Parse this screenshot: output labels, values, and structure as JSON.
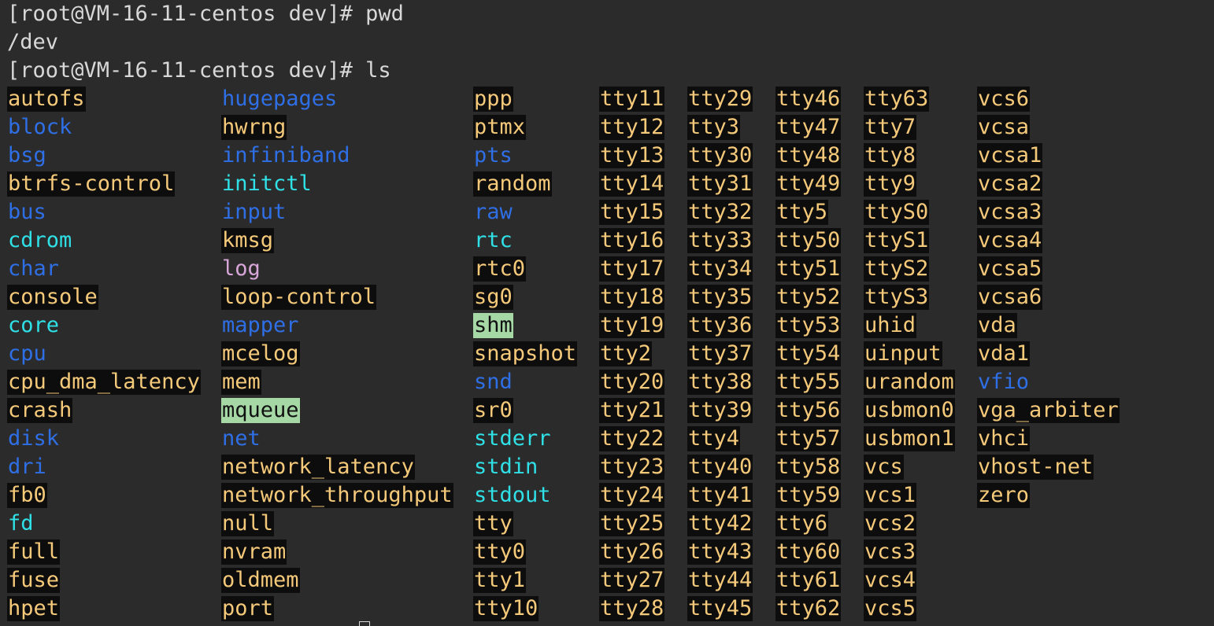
{
  "terminal": {
    "lines": [
      "[root@VM-16-11-centos dev]# pwd",
      "/dev",
      "[root@VM-16-11-centos dev]# ls"
    ],
    "columns": [
      [
        {
          "name": "autofs",
          "type": "dev"
        },
        {
          "name": "block",
          "type": "dir"
        },
        {
          "name": "bsg",
          "type": "dir"
        },
        {
          "name": "btrfs-control",
          "type": "dev"
        },
        {
          "name": "bus",
          "type": "dir"
        },
        {
          "name": "cdrom",
          "type": "link"
        },
        {
          "name": "char",
          "type": "dir"
        },
        {
          "name": "console",
          "type": "dev"
        },
        {
          "name": "core",
          "type": "link"
        },
        {
          "name": "cpu",
          "type": "dir"
        },
        {
          "name": "cpu_dma_latency",
          "type": "dev"
        },
        {
          "name": "crash",
          "type": "dev"
        },
        {
          "name": "disk",
          "type": "dir"
        },
        {
          "name": "dri",
          "type": "dir"
        },
        {
          "name": "fb0",
          "type": "dev"
        },
        {
          "name": "fd",
          "type": "link"
        },
        {
          "name": "full",
          "type": "dev"
        },
        {
          "name": "fuse",
          "type": "dev"
        },
        {
          "name": "hpet",
          "type": "dev"
        }
      ],
      [
        {
          "name": "hugepages",
          "type": "dir"
        },
        {
          "name": "hwrng",
          "type": "dev"
        },
        {
          "name": "infiniband",
          "type": "dir"
        },
        {
          "name": "initctl",
          "type": "link"
        },
        {
          "name": "input",
          "type": "dir"
        },
        {
          "name": "kmsg",
          "type": "dev"
        },
        {
          "name": "log",
          "type": "file"
        },
        {
          "name": "loop-control",
          "type": "dev"
        },
        {
          "name": "mapper",
          "type": "dir"
        },
        {
          "name": "mcelog",
          "type": "dev"
        },
        {
          "name": "mem",
          "type": "dev"
        },
        {
          "name": "mqueue",
          "type": "sticky"
        },
        {
          "name": "net",
          "type": "dir"
        },
        {
          "name": "network_latency",
          "type": "dev"
        },
        {
          "name": "network_throughput",
          "type": "dev"
        },
        {
          "name": "null",
          "type": "dev"
        },
        {
          "name": "nvram",
          "type": "dev"
        },
        {
          "name": "oldmem",
          "type": "dev"
        },
        {
          "name": "port",
          "type": "dev"
        }
      ],
      [
        {
          "name": "ppp",
          "type": "dev"
        },
        {
          "name": "ptmx",
          "type": "dev"
        },
        {
          "name": "pts",
          "type": "dir"
        },
        {
          "name": "random",
          "type": "dev"
        },
        {
          "name": "raw",
          "type": "dir"
        },
        {
          "name": "rtc",
          "type": "link"
        },
        {
          "name": "rtc0",
          "type": "dev"
        },
        {
          "name": "sg0",
          "type": "dev"
        },
        {
          "name": "shm",
          "type": "sticky"
        },
        {
          "name": "snapshot",
          "type": "dev"
        },
        {
          "name": "snd",
          "type": "dir"
        },
        {
          "name": "sr0",
          "type": "dev"
        },
        {
          "name": "stderr",
          "type": "link"
        },
        {
          "name": "stdin",
          "type": "link"
        },
        {
          "name": "stdout",
          "type": "link"
        },
        {
          "name": "tty",
          "type": "dev"
        },
        {
          "name": "tty0",
          "type": "dev"
        },
        {
          "name": "tty1",
          "type": "dev"
        },
        {
          "name": "tty10",
          "type": "dev"
        }
      ],
      [
        {
          "name": "tty11",
          "type": "dev"
        },
        {
          "name": "tty12",
          "type": "dev"
        },
        {
          "name": "tty13",
          "type": "dev"
        },
        {
          "name": "tty14",
          "type": "dev"
        },
        {
          "name": "tty15",
          "type": "dev"
        },
        {
          "name": "tty16",
          "type": "dev"
        },
        {
          "name": "tty17",
          "type": "dev"
        },
        {
          "name": "tty18",
          "type": "dev"
        },
        {
          "name": "tty19",
          "type": "dev"
        },
        {
          "name": "tty2",
          "type": "dev"
        },
        {
          "name": "tty20",
          "type": "dev"
        },
        {
          "name": "tty21",
          "type": "dev"
        },
        {
          "name": "tty22",
          "type": "dev"
        },
        {
          "name": "tty23",
          "type": "dev"
        },
        {
          "name": "tty24",
          "type": "dev"
        },
        {
          "name": "tty25",
          "type": "dev"
        },
        {
          "name": "tty26",
          "type": "dev"
        },
        {
          "name": "tty27",
          "type": "dev"
        },
        {
          "name": "tty28",
          "type": "dev"
        }
      ],
      [
        {
          "name": "tty29",
          "type": "dev"
        },
        {
          "name": "tty3",
          "type": "dev"
        },
        {
          "name": "tty30",
          "type": "dev"
        },
        {
          "name": "tty31",
          "type": "dev"
        },
        {
          "name": "tty32",
          "type": "dev"
        },
        {
          "name": "tty33",
          "type": "dev"
        },
        {
          "name": "tty34",
          "type": "dev"
        },
        {
          "name": "tty35",
          "type": "dev"
        },
        {
          "name": "tty36",
          "type": "dev"
        },
        {
          "name": "tty37",
          "type": "dev"
        },
        {
          "name": "tty38",
          "type": "dev"
        },
        {
          "name": "tty39",
          "type": "dev"
        },
        {
          "name": "tty4",
          "type": "dev"
        },
        {
          "name": "tty40",
          "type": "dev"
        },
        {
          "name": "tty41",
          "type": "dev"
        },
        {
          "name": "tty42",
          "type": "dev"
        },
        {
          "name": "tty43",
          "type": "dev"
        },
        {
          "name": "tty44",
          "type": "dev"
        },
        {
          "name": "tty45",
          "type": "dev"
        }
      ],
      [
        {
          "name": "tty46",
          "type": "dev"
        },
        {
          "name": "tty47",
          "type": "dev"
        },
        {
          "name": "tty48",
          "type": "dev"
        },
        {
          "name": "tty49",
          "type": "dev"
        },
        {
          "name": "tty5",
          "type": "dev"
        },
        {
          "name": "tty50",
          "type": "dev"
        },
        {
          "name": "tty51",
          "type": "dev"
        },
        {
          "name": "tty52",
          "type": "dev"
        },
        {
          "name": "tty53",
          "type": "dev"
        },
        {
          "name": "tty54",
          "type": "dev"
        },
        {
          "name": "tty55",
          "type": "dev"
        },
        {
          "name": "tty56",
          "type": "dev"
        },
        {
          "name": "tty57",
          "type": "dev"
        },
        {
          "name": "tty58",
          "type": "dev"
        },
        {
          "name": "tty59",
          "type": "dev"
        },
        {
          "name": "tty6",
          "type": "dev"
        },
        {
          "name": "tty60",
          "type": "dev"
        },
        {
          "name": "tty61",
          "type": "dev"
        },
        {
          "name": "tty62",
          "type": "dev"
        }
      ],
      [
        {
          "name": "tty63",
          "type": "dev"
        },
        {
          "name": "tty7",
          "type": "dev"
        },
        {
          "name": "tty8",
          "type": "dev"
        },
        {
          "name": "tty9",
          "type": "dev"
        },
        {
          "name": "ttyS0",
          "type": "dev"
        },
        {
          "name": "ttyS1",
          "type": "dev"
        },
        {
          "name": "ttyS2",
          "type": "dev"
        },
        {
          "name": "ttyS3",
          "type": "dev"
        },
        {
          "name": "uhid",
          "type": "dev"
        },
        {
          "name": "uinput",
          "type": "dev"
        },
        {
          "name": "urandom",
          "type": "dev"
        },
        {
          "name": "usbmon0",
          "type": "dev"
        },
        {
          "name": "usbmon1",
          "type": "dev"
        },
        {
          "name": "vcs",
          "type": "dev"
        },
        {
          "name": "vcs1",
          "type": "dev"
        },
        {
          "name": "vcs2",
          "type": "dev"
        },
        {
          "name": "vcs3",
          "type": "dev"
        },
        {
          "name": "vcs4",
          "type": "dev"
        },
        {
          "name": "vcs5",
          "type": "dev"
        }
      ],
      [
        {
          "name": "vcs6",
          "type": "dev"
        },
        {
          "name": "vcsa",
          "type": "dev"
        },
        {
          "name": "vcsa1",
          "type": "dev"
        },
        {
          "name": "vcsa2",
          "type": "dev"
        },
        {
          "name": "vcsa3",
          "type": "dev"
        },
        {
          "name": "vcsa4",
          "type": "dev"
        },
        {
          "name": "vcsa5",
          "type": "dev"
        },
        {
          "name": "vcsa6",
          "type": "dev"
        },
        {
          "name": "vda",
          "type": "dev"
        },
        {
          "name": "vda1",
          "type": "dev"
        },
        {
          "name": "vfio",
          "type": "dir"
        },
        {
          "name": "vga_arbiter",
          "type": "dev"
        },
        {
          "name": "vhci",
          "type": "dev"
        },
        {
          "name": "vhost-net",
          "type": "dev"
        },
        {
          "name": "zero",
          "type": "dev"
        }
      ]
    ],
    "colors": {
      "background": "#2b2b2b",
      "text": "#d8d8d8",
      "directory": "#2f6fe6",
      "symlink": "#2fe0e6",
      "device_fg": "#f5c97a",
      "device_bg": "#0d0d0d",
      "socket": "#d8a6d8",
      "sticky_bg": "#a6d8a6"
    }
  }
}
